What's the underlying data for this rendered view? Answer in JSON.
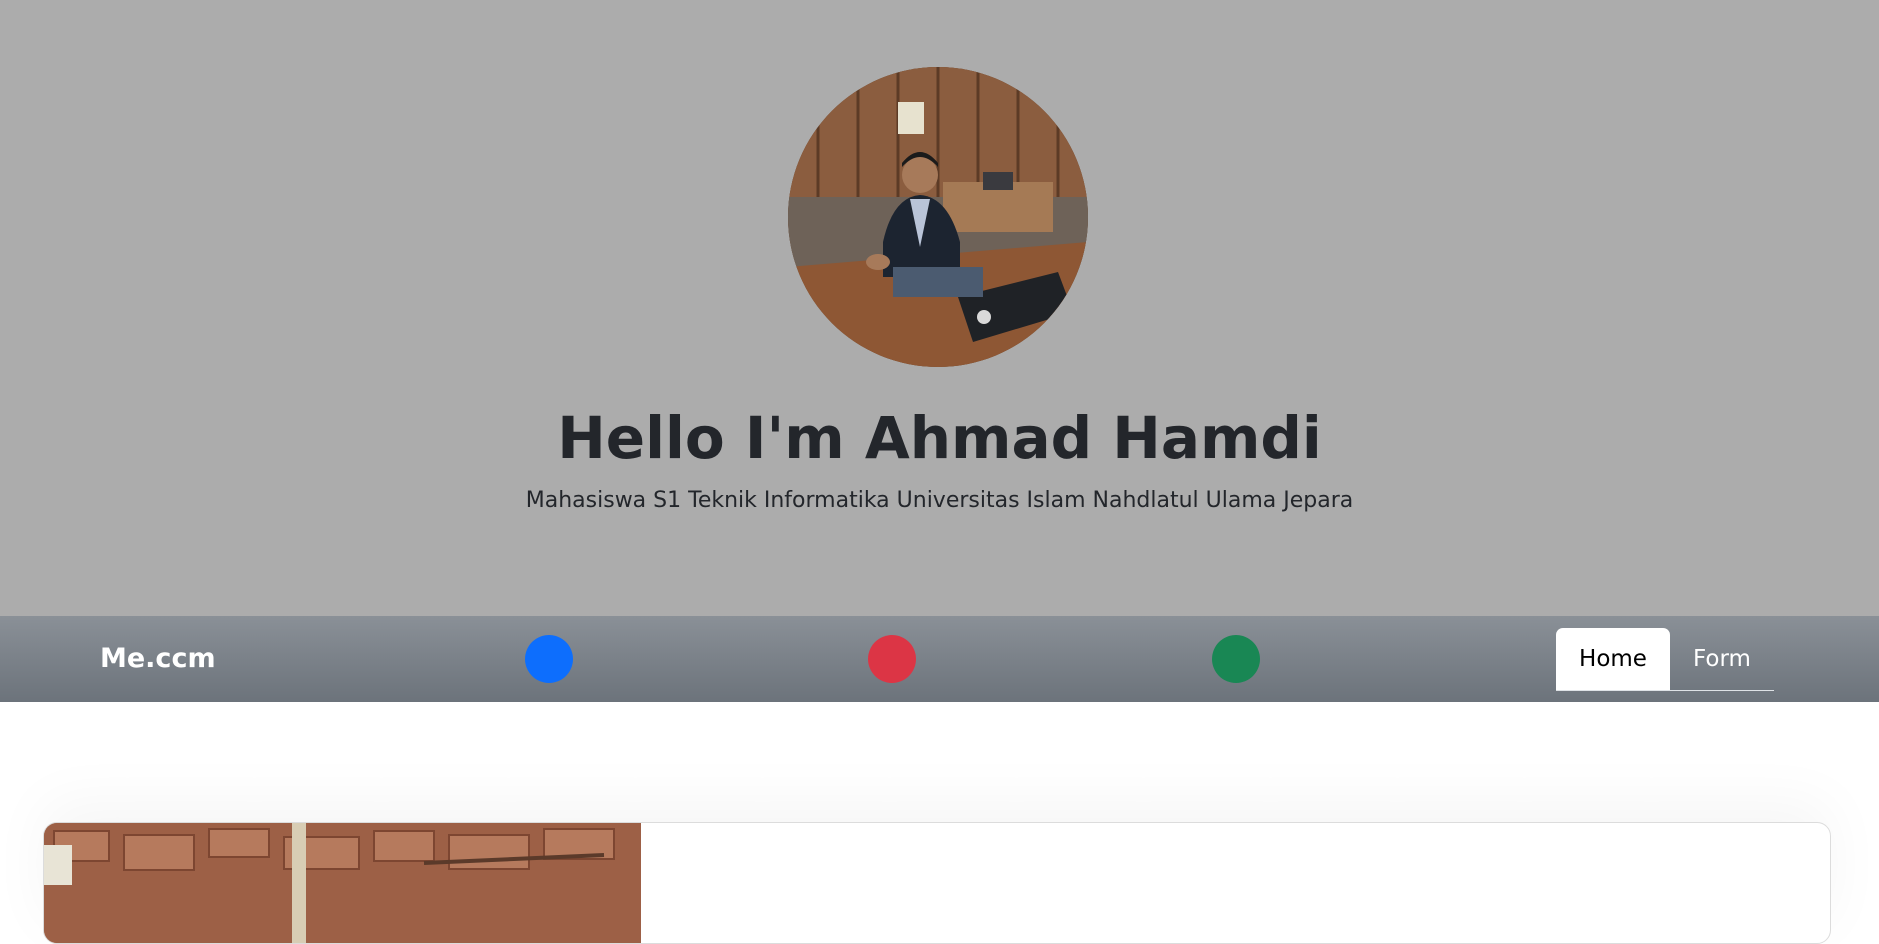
{
  "hero": {
    "title": "Hello I'm Ahmad Hamdi",
    "subtitle": "Mahasiswa S1 Teknik Informatika Universitas Islam Nahdlatul Ulama Jepara",
    "background_color": "#acacac"
  },
  "navbar": {
    "brand": "Me.ccm",
    "dots": [
      {
        "name": "blue-dot",
        "color": "#0d6efd"
      },
      {
        "name": "red-dot",
        "color": "#dc3545"
      },
      {
        "name": "green-dot",
        "color": "#198754"
      }
    ],
    "tabs": [
      {
        "label": "Home",
        "active": true
      },
      {
        "label": "Form",
        "active": false
      }
    ]
  }
}
